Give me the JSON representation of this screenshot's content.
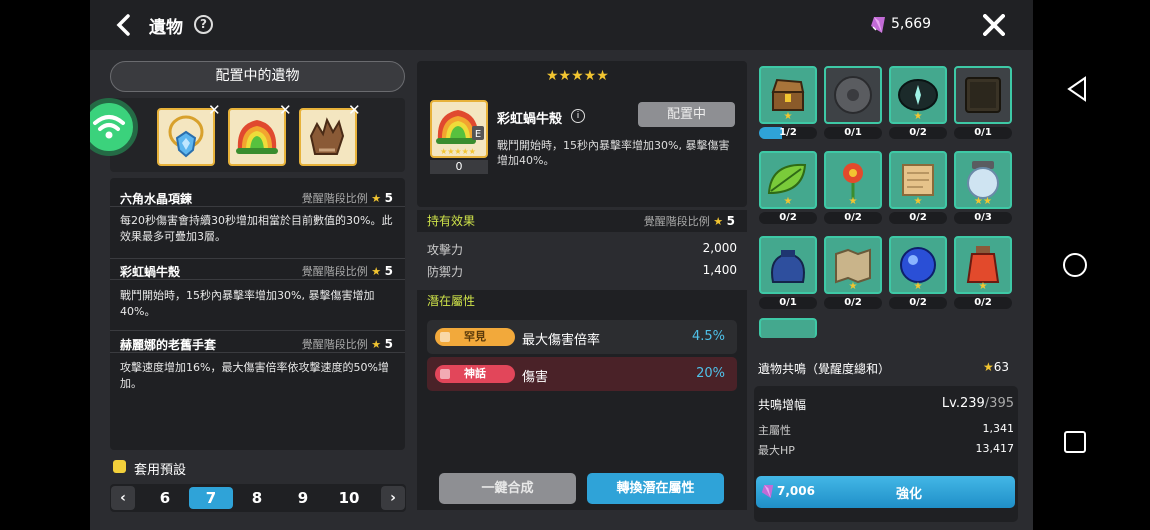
{
  "header": {
    "title": "遺物",
    "currency_value": "5,669"
  },
  "left": {
    "equipped_button": "配置中的遺物",
    "details": [
      {
        "name": "六角水晶項鍊",
        "ratio_label": "覺醒階段比例",
        "ratio_value": "5",
        "desc": "每20秒傷害會持續30秒增加相當於目前數值的30%。此效果最多可疊加3層。"
      },
      {
        "name": "彩虹蝸牛殼",
        "ratio_label": "覺醒階段比例",
        "ratio_value": "5",
        "desc": "戰鬥開始時，15秒內暴擊率增加30%, 暴擊傷害增加40%。"
      },
      {
        "name": "赫麗娜的老舊手套",
        "ratio_label": "覺醒階段比例",
        "ratio_value": "5",
        "desc": "攻擊速度增加16%，最大傷害倍率依攻擊速度的50%增加。"
      }
    ],
    "preset_label": "套用預設",
    "pages": [
      "6",
      "7",
      "8",
      "9",
      "10"
    ],
    "selected_page": "7"
  },
  "middle": {
    "stars": "★★★★★",
    "relic_name": "彩虹蝸牛殼",
    "grade_letter": "E",
    "level": "0",
    "status_button": "配置中",
    "relic_desc": "戰鬥開始時，15秒內暴擊率增加30%, 暴擊傷害增加40%。",
    "owned_effect": {
      "title": "持有效果",
      "ratio_label": "覺醒階段比例",
      "ratio_value": "5",
      "stats": [
        {
          "name": "攻擊力",
          "value": "2,000"
        },
        {
          "name": "防禦力",
          "value": "1,400"
        }
      ]
    },
    "potential": {
      "title": "潛在屬性",
      "rows": [
        {
          "grade": "罕見",
          "name": "最大傷害倍率",
          "value": "4.5%",
          "color": "#f2a93b"
        },
        {
          "grade": "神話",
          "name": "傷害",
          "value": "20%",
          "color": "#e2465a"
        }
      ]
    },
    "combine_button": "一鍵合成",
    "reroll_button": "轉換潛在屬性"
  },
  "right": {
    "items": [
      {
        "name": "treasure-chest",
        "count": "1/2",
        "stars": "★",
        "bg": "teal"
      },
      {
        "name": "gray-disc",
        "count": "0/1",
        "stars": "",
        "bg": "dark"
      },
      {
        "name": "dark-orb",
        "count": "0/2",
        "stars": "★",
        "bg": "teal"
      },
      {
        "name": "dark-box",
        "count": "0/1",
        "stars": "",
        "bg": "dark"
      },
      {
        "name": "green-leaf",
        "count": "0/2",
        "stars": "★",
        "bg": "teal"
      },
      {
        "name": "red-flower",
        "count": "0/2",
        "stars": "★",
        "bg": "teal"
      },
      {
        "name": "scroll",
        "count": "0/2",
        "stars": "★",
        "bg": "teal"
      },
      {
        "name": "crystal-jar",
        "count": "0/3",
        "stars": "★★",
        "bg": "teal"
      },
      {
        "name": "blue-pouch",
        "count": "0/1",
        "stars": "",
        "bg": "teal"
      },
      {
        "name": "old-map",
        "count": "0/2",
        "stars": "★",
        "bg": "teal"
      },
      {
        "name": "blue-orb",
        "count": "0/2",
        "stars": "★",
        "bg": "teal"
      },
      {
        "name": "red-potion",
        "count": "0/2",
        "stars": "★",
        "bg": "teal"
      }
    ],
    "resonance_label": "遺物共鳴（覺醒度總和）",
    "resonance_value": "63",
    "boost_label": "共鳴增幅",
    "boost_level": "Lv.239",
    "boost_max": "/395",
    "main_stat_label": "主屬性",
    "main_stat_value": "1,341",
    "hp_label": "最大HP",
    "hp_value": "13,417",
    "upgrade_cost": "7,006",
    "upgrade_label": "強化"
  }
}
